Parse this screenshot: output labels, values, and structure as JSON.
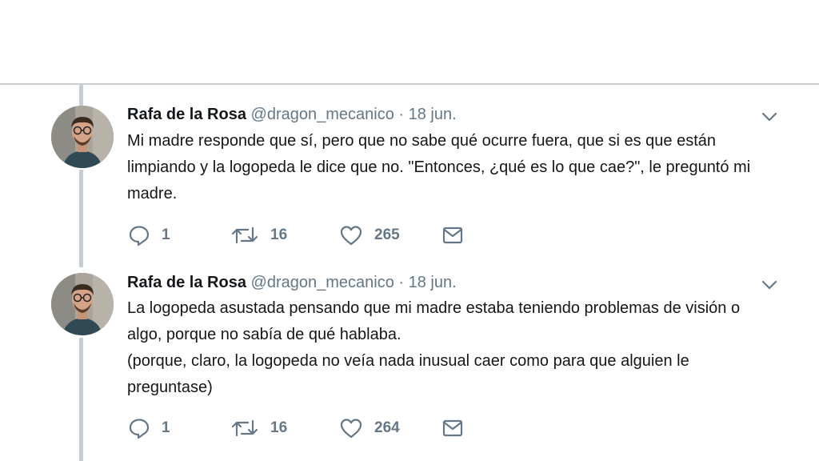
{
  "tweets": [
    {
      "author_name": "Rafa de la Rosa",
      "handle": "@dragon_mecanico",
      "separator": "·",
      "date": "18 jun.",
      "text_lines": [
        "Mi madre responde que sí, pero que no sabe qué ocurre fuera, que si es que están limpiando y la logopeda le dice que no. \"Entonces, ¿qué es lo que cae?\", le preguntó mi madre."
      ],
      "replies": "1",
      "retweets": "16",
      "likes": "265"
    },
    {
      "author_name": "Rafa de la Rosa",
      "handle": "@dragon_mecanico",
      "separator": "·",
      "date": "18 jun.",
      "text_lines": [
        "La logopeda asustada pensando que mi madre estaba teniendo problemas de visión o algo, porque no sabía de qué hablaba.",
        "(porque, claro, la logopeda no veía nada inusual caer como para que alguien le preguntase)"
      ],
      "replies": "1",
      "retweets": "16",
      "likes": "264"
    }
  ],
  "icons": {
    "reply": "reply-icon",
    "retweet": "retweet-icon",
    "like": "heart-icon",
    "dm": "envelope-icon",
    "caret": "chevron-down-icon",
    "avatar": "avatar"
  },
  "colors": {
    "text": "#14171a",
    "secondary": "#657786",
    "thread_line": "#c4cdd5",
    "border": "#c8ccd0"
  }
}
